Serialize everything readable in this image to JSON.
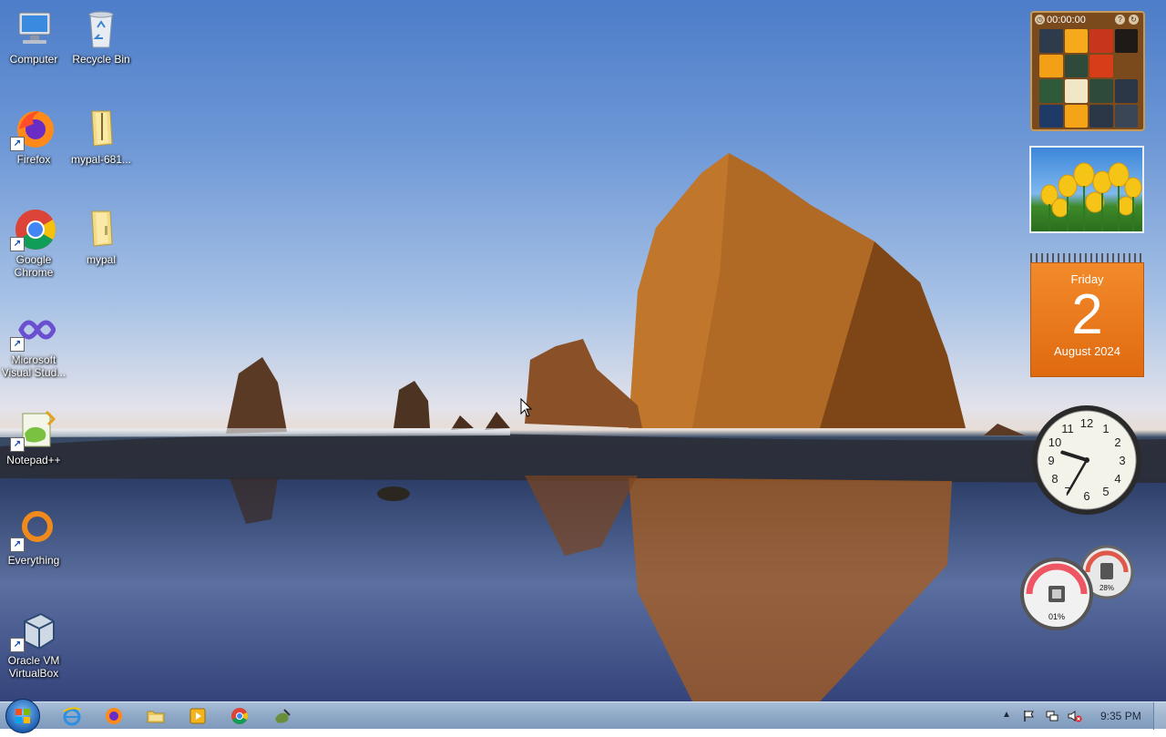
{
  "desktop_icons": [
    {
      "label": "Computer"
    },
    {
      "label": "Recycle Bin"
    },
    {
      "label": "Firefox"
    },
    {
      "label": "mypal-681..."
    },
    {
      "label": "Google Chrome"
    },
    {
      "label": "mypal"
    },
    {
      "label": "Microsoft Visual Stud..."
    },
    {
      "label": "Notepad++"
    },
    {
      "label": "Everything"
    },
    {
      "label": "Oracle VM VirtualBox"
    }
  ],
  "gadgets": {
    "puzzle": {
      "timer": "00:00:00"
    },
    "calendar": {
      "weekday": "Friday",
      "day": "2",
      "month_year": "August 2024"
    },
    "clock": {
      "hour": 9,
      "minute": 35
    },
    "meter": {
      "cpu": "01%",
      "memory": "28%"
    }
  },
  "taskbar": {
    "pinned": [
      "internet-explorer",
      "firefox",
      "file-explorer",
      "media-player",
      "chrome",
      "notepad-plus-plus"
    ],
    "clock": "9:35 PM"
  }
}
